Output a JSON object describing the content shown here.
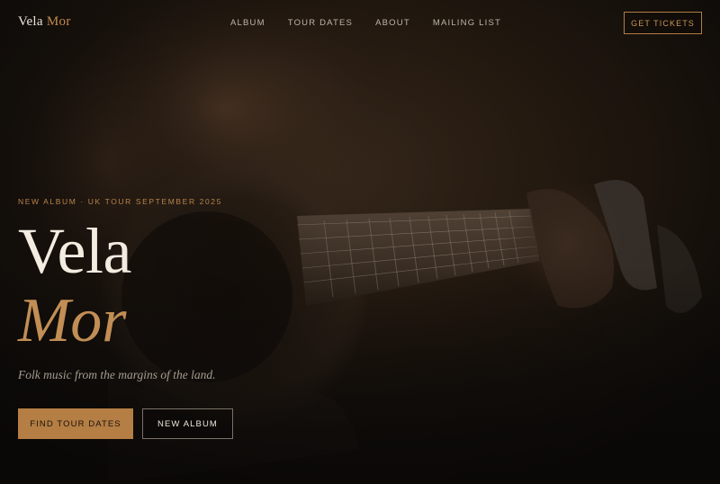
{
  "brand": {
    "first": "Vela",
    "second": "Mor"
  },
  "nav": {
    "items": [
      {
        "label": "ALBUM"
      },
      {
        "label": "TOUR DATES"
      },
      {
        "label": "ABOUT"
      },
      {
        "label": "MAILING LIST"
      }
    ],
    "cta_label": "GET TICKETS"
  },
  "hero": {
    "eyebrow": "NEW ALBUM · UK TOUR SEPTEMBER 2025",
    "title_line1": "Vela",
    "title_line2": "Mor",
    "tagline": "Folk music from the margins of the land.",
    "primary_button": "FIND TOUR DATES",
    "secondary_button": "NEW ALBUM",
    "background_image": "guitarist-playing-acoustic-guitar"
  },
  "colors": {
    "accent": "#b47e44",
    "background": "#0d0b09",
    "text": "#f3ece1"
  }
}
